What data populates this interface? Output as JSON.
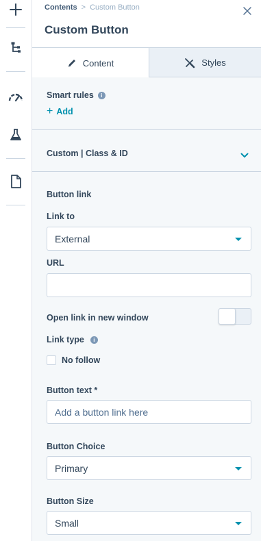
{
  "rail": {
    "icons": [
      "add-icon",
      "tree-structure-icon",
      "speedometer-icon",
      "flask-icon",
      "page-icon"
    ]
  },
  "breadcrumb": {
    "parent": "Contents",
    "separator": ">",
    "current": "Custom Button"
  },
  "header": {
    "title": "Custom Button",
    "close_icon": "close-icon"
  },
  "tabs": [
    {
      "label": "Content",
      "icon": "pencil-icon",
      "active": true
    },
    {
      "label": "Styles",
      "icon": "brush-icon",
      "active": false
    }
  ],
  "smart_rules": {
    "label": "Smart rules",
    "info_icon": "i",
    "add_label": "Add"
  },
  "accordion": {
    "label": "Custom | Class & ID"
  },
  "form": {
    "button_link_heading": "Button link",
    "link_to": {
      "label": "Link to",
      "value": "External"
    },
    "url": {
      "label": "URL",
      "value": ""
    },
    "open_new_window": {
      "label": "Open link in new window",
      "on": false
    },
    "link_type": {
      "label": "Link type",
      "info_icon": "i"
    },
    "no_follow": {
      "label": "No follow",
      "checked": false
    },
    "button_text": {
      "label": "Button text *",
      "placeholder": "Add a button link here"
    },
    "button_choice": {
      "label": "Button Choice",
      "value": "Primary"
    },
    "button_size": {
      "label": "Button Size",
      "value": "Small"
    }
  },
  "colors": {
    "accent": "#0091ae",
    "text": "#33475b",
    "border": "#cbd6e2",
    "panel_bg": "#f5f8fa"
  }
}
